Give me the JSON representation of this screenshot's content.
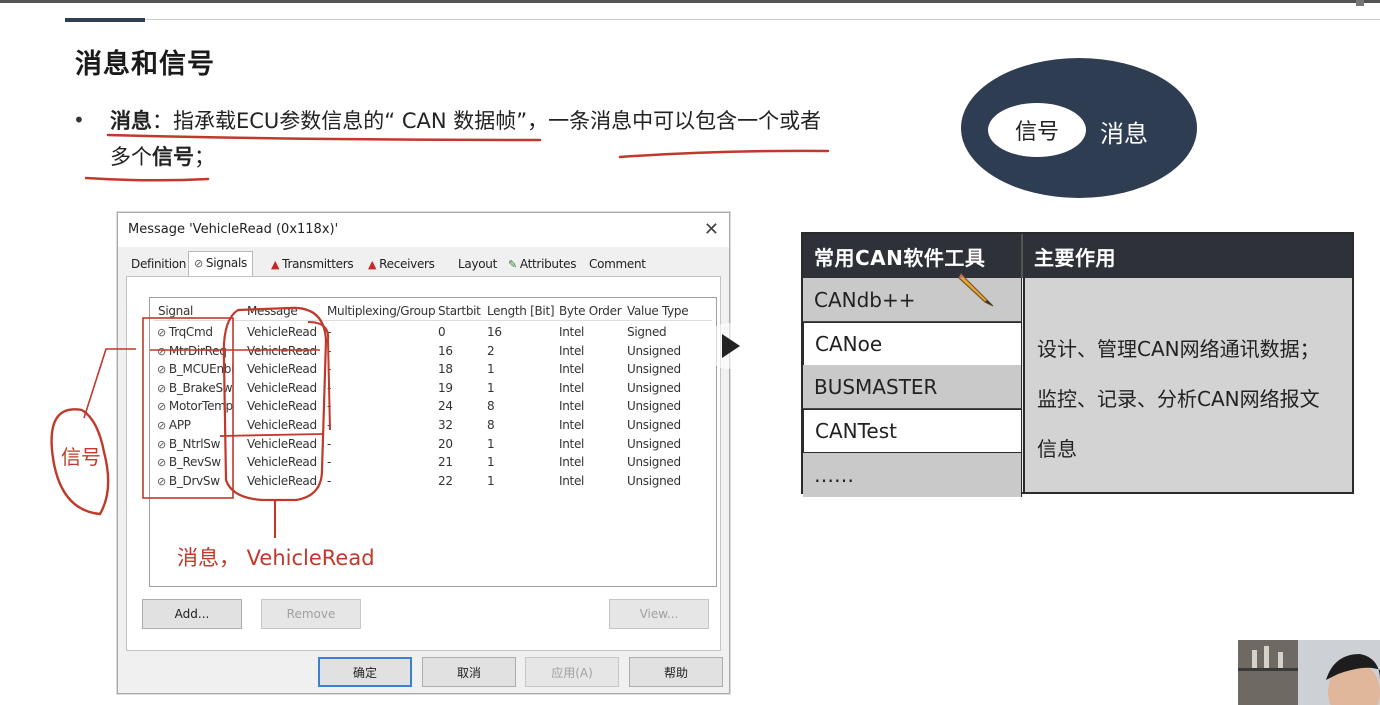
{
  "slide": {
    "title": "消息和信号",
    "bullet": {
      "term": "消息",
      "text_a": "：指承载ECU参数信息的“ CAN 数据帧”，一条消息中可以包含一个或者",
      "text_b": "多个",
      "term2": "信号",
      "text_c": "；"
    }
  },
  "diagram": {
    "inner_label": "信号",
    "outer_label": "消息",
    "outer_color": "#2e3d52"
  },
  "dialog": {
    "title": "Message 'VehicleRead (0x118x)'",
    "close_glyph": "✕",
    "tabs": [
      {
        "label": "Definition"
      },
      {
        "label": "Signals"
      },
      {
        "label": "Transmitters"
      },
      {
        "label": "Receivers"
      },
      {
        "label": "Layout"
      },
      {
        "label": "Attributes"
      },
      {
        "label": "Comment"
      }
    ],
    "active_tab": "Signals",
    "columns": [
      "Signal",
      "Message",
      "Multiplexing/Group",
      "Startbit",
      "Length [Bit]",
      "Byte Order",
      "Value Type"
    ],
    "rows": [
      {
        "signal": "TrqCmd",
        "message": "VehicleRead",
        "mux": "-",
        "startbit": "0",
        "length": "16",
        "order": "Intel",
        "type": "Signed"
      },
      {
        "signal": "MtrDirReq",
        "message": "VehicleRead",
        "mux": "-",
        "startbit": "16",
        "length": "2",
        "order": "Intel",
        "type": "Unsigned"
      },
      {
        "signal": "B_MCUEnbl",
        "message": "VehicleRead",
        "mux": "-",
        "startbit": "18",
        "length": "1",
        "order": "Intel",
        "type": "Unsigned"
      },
      {
        "signal": "B_BrakeSw",
        "message": "VehicleRead",
        "mux": "-",
        "startbit": "19",
        "length": "1",
        "order": "Intel",
        "type": "Unsigned"
      },
      {
        "signal": "MotorTemp",
        "message": "VehicleRead",
        "mux": "-",
        "startbit": "24",
        "length": "8",
        "order": "Intel",
        "type": "Unsigned"
      },
      {
        "signal": "APP",
        "message": "VehicleRead",
        "mux": "-",
        "startbit": "32",
        "length": "8",
        "order": "Intel",
        "type": "Unsigned"
      },
      {
        "signal": "B_NtrlSw",
        "message": "VehicleRead",
        "mux": "-",
        "startbit": "20",
        "length": "1",
        "order": "Intel",
        "type": "Unsigned"
      },
      {
        "signal": "B_RevSw",
        "message": "VehicleRead",
        "mux": "-",
        "startbit": "21",
        "length": "1",
        "order": "Intel",
        "type": "Unsigned"
      },
      {
        "signal": "B_DrvSw",
        "message": "VehicleRead",
        "mux": "-",
        "startbit": "22",
        "length": "1",
        "order": "Intel",
        "type": "Unsigned"
      }
    ],
    "buttons": {
      "add": "Add...",
      "remove": "Remove",
      "view": "View...",
      "ok": "确定",
      "cancel": "取消",
      "apply": "应用(A)",
      "help": "帮助"
    }
  },
  "annotations": {
    "signal_label": "信号",
    "message_label": "消息， VehicleRead",
    "ink_color": "#c0392b"
  },
  "tool_table": {
    "headers": [
      "常用CAN软件工具",
      "主要作用"
    ],
    "tools": [
      "CANdb++",
      "CANoe",
      "BUSMASTER",
      "CANTest",
      "……"
    ],
    "description_lines": [
      "设计、管理CAN网络通讯数据；",
      "监控、记录、分析CAN网络报文",
      "信息"
    ]
  }
}
